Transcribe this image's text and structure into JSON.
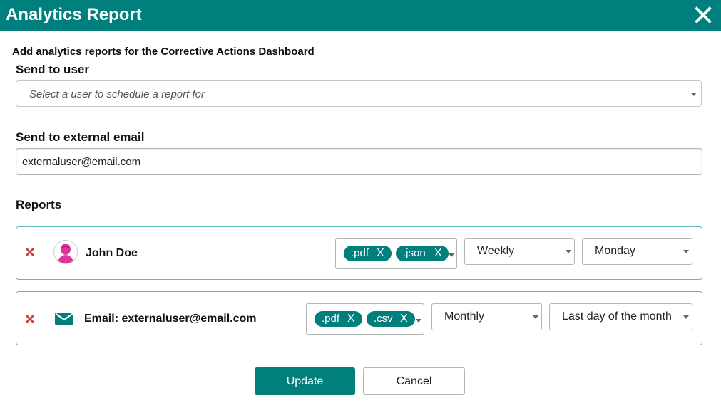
{
  "dialog": {
    "title": "Analytics Report",
    "subtitle": "Add analytics reports for the Corrective Actions Dashboard"
  },
  "send_to_user": {
    "label": "Send to user",
    "placeholder": "Select a user to schedule a report for"
  },
  "send_to_email": {
    "label": "Send to external email",
    "value": "externaluser@email.com"
  },
  "reports": {
    "label": "Reports",
    "items": [
      {
        "name": "John Doe",
        "formats": [
          ".pdf",
          ".json"
        ],
        "frequency": "Weekly",
        "day": "Monday"
      },
      {
        "name": "Email: externaluser@email.com",
        "formats": [
          ".pdf",
          ".csv"
        ],
        "frequency": "Monthly",
        "day": "Last day of the month"
      }
    ],
    "chip_remove": "X"
  },
  "buttons": {
    "update": "Update",
    "cancel": "Cancel"
  },
  "colors": {
    "accent": "#017f7c",
    "delete": "#c9463d",
    "avatar": "#e0359a"
  }
}
